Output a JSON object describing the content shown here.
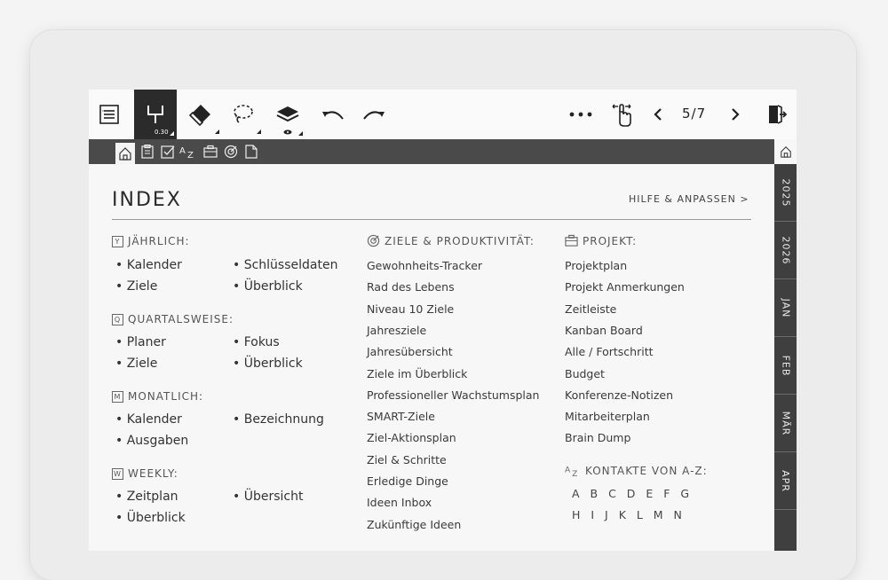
{
  "toolbar": {
    "pen_size": "0.30",
    "page_indicator": "5/7"
  },
  "header": {
    "title": "INDEX",
    "help": "HILFE & ANPASSEN >"
  },
  "side_tabs": [
    "2025",
    "2026",
    "JAN",
    "FEB",
    "MÄR",
    "APR"
  ],
  "sections": {
    "yearly": {
      "icon": "Y",
      "label": "JÄHRLICH:",
      "items": [
        "• Kalender",
        "• Schlüsseldaten",
        "• Ziele",
        "• Überblick"
      ]
    },
    "quarterly": {
      "icon": "Q",
      "label": "QUARTALSWEISE:",
      "items": [
        "• Planer",
        "• Fokus",
        "• Ziele",
        "• Überblick"
      ]
    },
    "monthly": {
      "icon": "M",
      "label": "MONATLICH:",
      "items": [
        "• Kalender",
        "• Bezeichnung",
        "• Ausgaben"
      ]
    },
    "weekly": {
      "icon": "W",
      "label": "WEEKLY:",
      "items": [
        "• Zeitplan",
        "• Übersicht",
        "• Überblick"
      ]
    }
  },
  "goals": {
    "label": "ZIELE & PRODUKTIVITÄT:",
    "items": [
      "Gewohnheits-Tracker",
      "Rad des Lebens",
      "Niveau 10 Ziele",
      "Jahresziele",
      "Jahresübersicht",
      "Ziele im Überblick",
      "Professioneller Wachstumsplan",
      "SMART-Ziele",
      "Ziel-Aktionsplan",
      "Ziel & Schritte",
      "Erledige Dinge",
      "Ideen Inbox",
      "Zukünftige Ideen"
    ]
  },
  "project": {
    "label": "PROJEKT:",
    "items": [
      "Projektplan",
      "Projekt Anmerkungen",
      "Zeitleiste",
      "Kanban Board",
      "Alle / Fortschritt",
      "Budget",
      "Konferenze-Notizen",
      "Mitarbeiterplan",
      "Brain Dump"
    ]
  },
  "contacts": {
    "label": "KONTAKTE VON A-Z:",
    "row1": "A B C D E F G",
    "row2": "H I J K L M N"
  }
}
